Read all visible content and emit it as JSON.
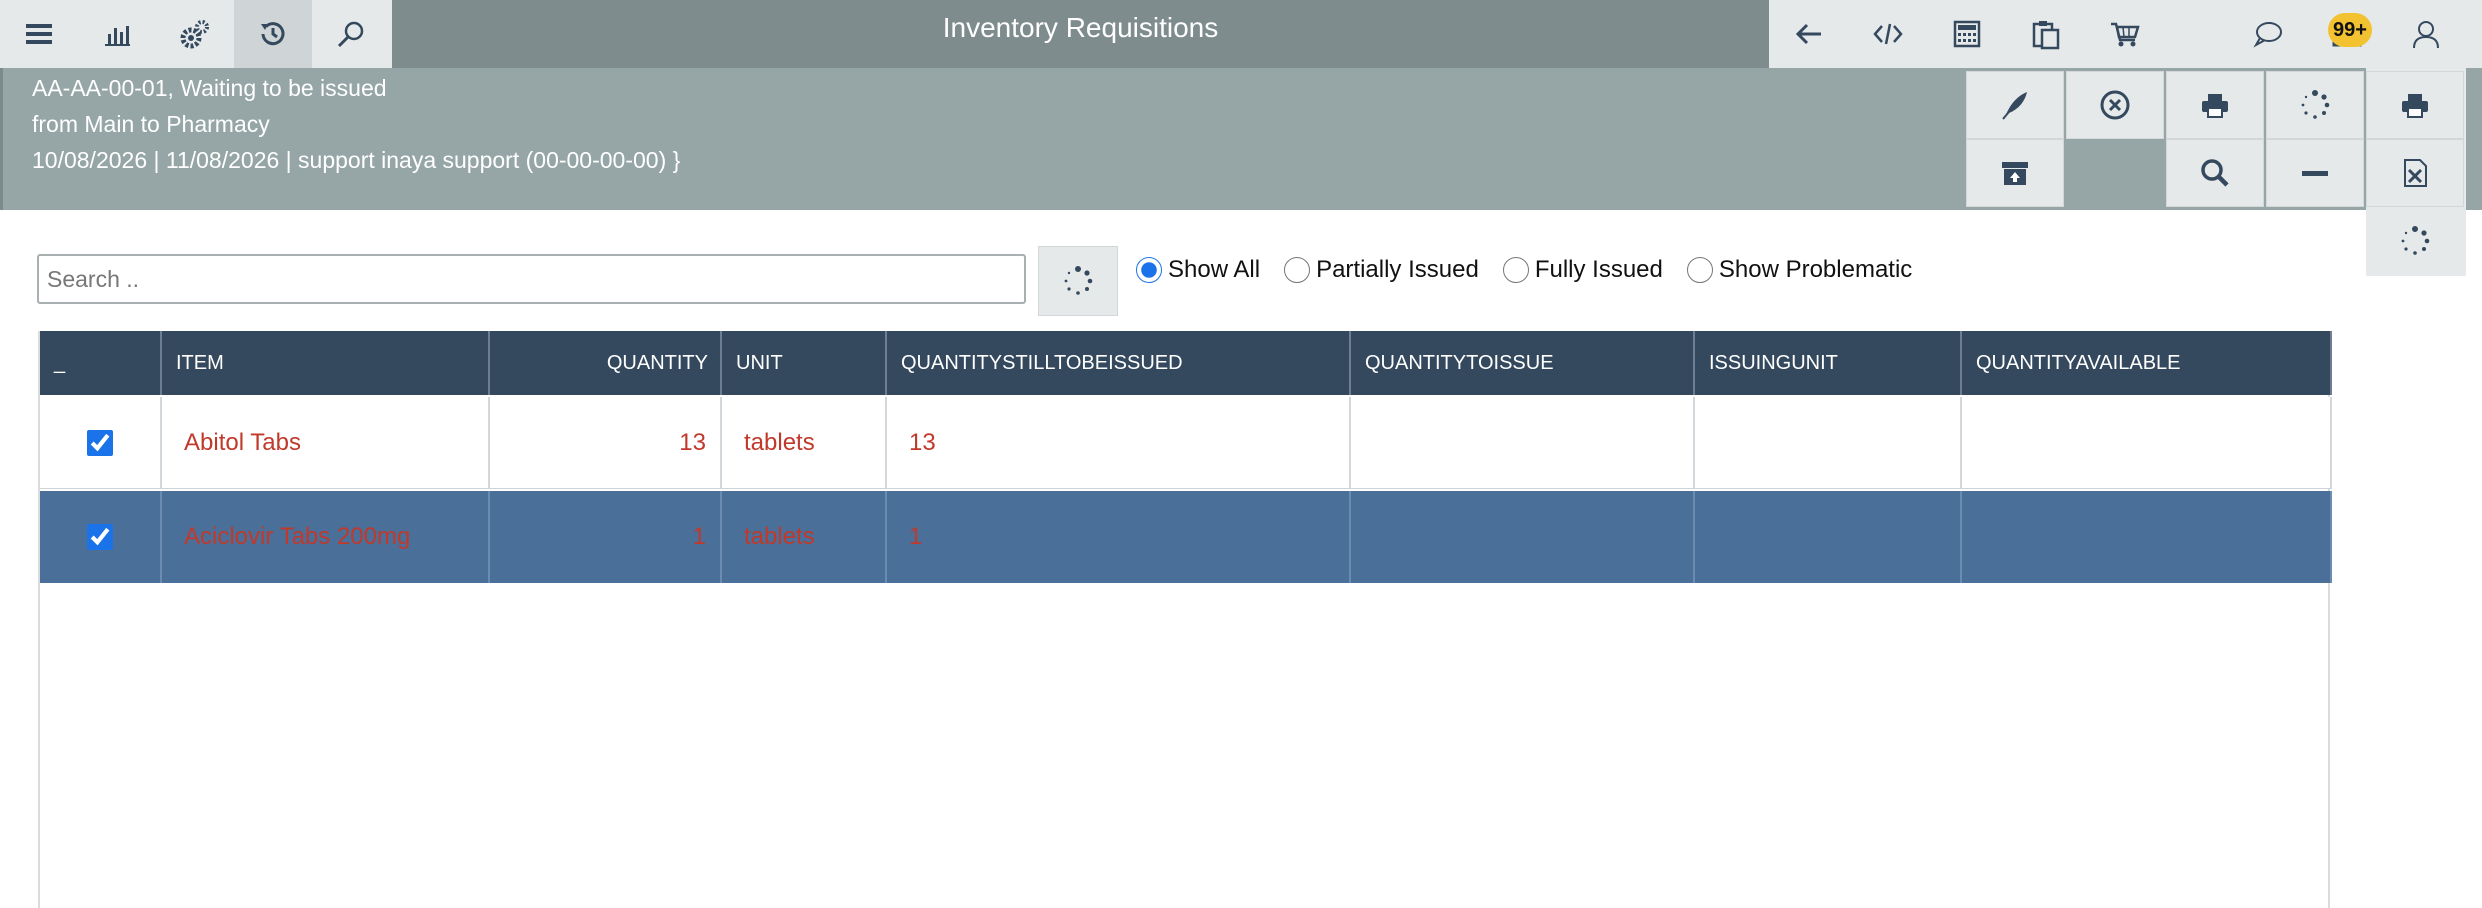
{
  "app": {
    "title": "Inventory Requisitions"
  },
  "topbar": {
    "left_icons": [
      "menu-icon",
      "bar-chart-icon",
      "gears-icon",
      "history-icon",
      "search-icon"
    ],
    "right_icons": [
      "arrow-left-icon",
      "code-icon",
      "calculator-icon",
      "clipboard-icon",
      "cart-icon",
      "chat-icon",
      "mail-icon",
      "user-icon"
    ],
    "notifications_badge": "99+"
  },
  "requisition": {
    "line1": "AA-AA-00-01, Waiting to be issued",
    "line2": "from Main to Pharmacy",
    "line3": "10/08/2026 | 11/08/2026 | support inaya support (00-00-00-00) }"
  },
  "actions": [
    "sign-icon",
    "cancel-icon",
    "print-icon",
    "spinner-icon",
    "print-icon",
    "archive-icon",
    "search-icon",
    "minus-icon",
    "excel-icon",
    "spinner-icon"
  ],
  "search": {
    "placeholder": "Search ..",
    "value": ""
  },
  "filters": {
    "selected": "Show All",
    "options": [
      "Show All",
      "Partially Issued",
      "Fully Issued",
      "Show Problematic"
    ]
  },
  "table": {
    "columns": [
      "_",
      "ITEM",
      "QUANTITY",
      "UNIT",
      "QUANTITYSTILLTOBEISSUED",
      "QUANTITYTOISSUE",
      "ISSUINGUNIT",
      "QUANTITYAVAILABLE"
    ],
    "rows": [
      {
        "checked": true,
        "item": "Abitol Tabs",
        "quantity": "13",
        "unit": "tablets",
        "still_to_issue": "13",
        "to_issue": "",
        "issuing_unit": "",
        "available": "",
        "selected": false
      },
      {
        "checked": true,
        "item": "Aciclovir Tabs 200mg",
        "quantity": "1",
        "unit": "tablets",
        "still_to_issue": "1",
        "to_issue": "",
        "issuing_unit": "",
        "available": "",
        "selected": true
      }
    ]
  },
  "colors": {
    "topbar": "#7f8c8d",
    "subheader": "#96a5a6",
    "table_header": "#34495e",
    "selected_row": "#4a6f99",
    "row_text": "#c0392b",
    "badge": "#f2c230"
  }
}
